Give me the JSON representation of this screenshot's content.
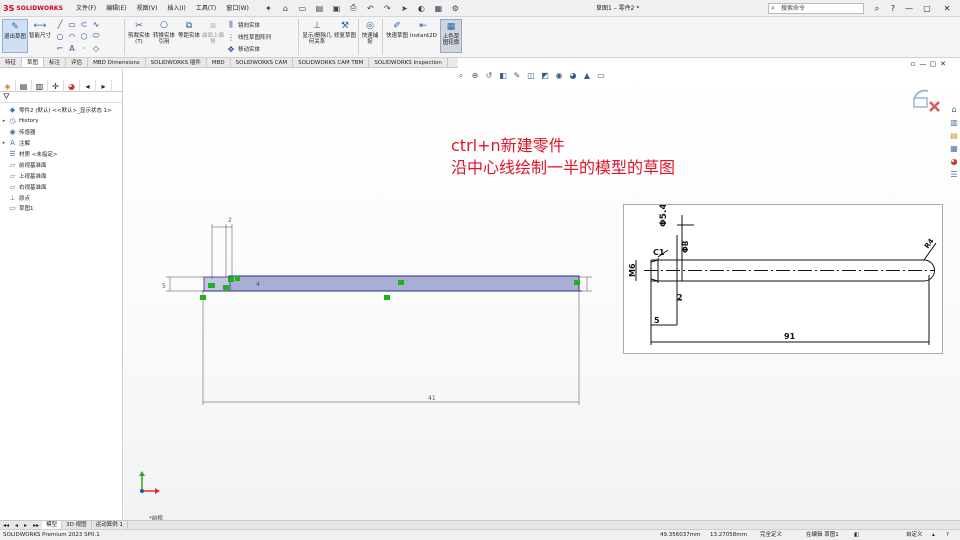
{
  "app": {
    "brand": "SOLIDWORKS",
    "document_title": "草图1 – 零件2 *"
  },
  "menu": [
    "文件(F)",
    "编辑(E)",
    "视图(V)",
    "插入(I)",
    "工具(T)",
    "窗口(W)"
  ],
  "search": {
    "placeholder": "搜索命令"
  },
  "ribbon": {
    "exit_sketch": "退出草图",
    "smart_dim": "智能尺寸",
    "trim": "剪裁实体(T)",
    "convert": "转换实体引用",
    "offset": "等距实体",
    "offset_surface": "曲面上偏移",
    "mirror": "镜向实体",
    "linear_pattern": "线性草图阵列",
    "move": "移动实体",
    "display_relations": "显示/删除几何关系",
    "repair": "修复草图",
    "rapid_snaps": "快速捕捉",
    "rapid_sketch": "快速草图",
    "instant2d": "Instant2D",
    "shaded_contours": "上色草图轮廓"
  },
  "command_tabs": [
    "特征",
    "草图",
    "标注",
    "评估",
    "MBD Dimensions",
    "SOLIDWORKS 插件",
    "MBD",
    "SOLIDWORKS CAM",
    "SOLIDWORKS CAM TBM",
    "SOLIDWORKS Inspection"
  ],
  "tree": [
    {
      "label": "零件2 (默认) <<默认>_显示状态 1>",
      "icon": "part-icon",
      "exp": ""
    },
    {
      "label": "History",
      "icon": "history-icon",
      "exp": "▸"
    },
    {
      "label": "传感器",
      "icon": "sensor-icon",
      "exp": ""
    },
    {
      "label": "注解",
      "icon": "annotation-icon",
      "exp": "▸"
    },
    {
      "label": "材质 <未指定>",
      "icon": "material-icon",
      "exp": ""
    },
    {
      "label": "前视基准面",
      "icon": "plane-icon",
      "exp": ""
    },
    {
      "label": "上视基准面",
      "icon": "plane-icon",
      "exp": ""
    },
    {
      "label": "右视基准面",
      "icon": "plane-icon",
      "exp": ""
    },
    {
      "label": "原点",
      "icon": "origin-icon",
      "exp": ""
    },
    {
      "label": "草图1",
      "icon": "sketch-icon",
      "exp": ""
    }
  ],
  "note": {
    "line1": "ctrl+n新建零件",
    "line2": "沿中心线绘制一半的模型的草图"
  },
  "sketch": {
    "dim_length": "41",
    "dim_top": "2",
    "dim_left": "5",
    "dim_right": "4"
  },
  "reference": {
    "d1": "Φ5.4",
    "d2": "Φ8",
    "c1": "C1",
    "m6": "M6",
    "r": "R4",
    "dim2": "2",
    "dim5": "5",
    "dim91": "91"
  },
  "view_name": "*前视",
  "model_tabs": [
    "模型",
    "3D 视图",
    "运动算例 1"
  ],
  "status": {
    "version": "SOLIDWORKS Premium 2023 SP0.1",
    "x": "49.356037mm",
    "y": "13.27058mm",
    "defined": "完全定义",
    "editing": "在编辑 草图1",
    "units": "自定义"
  },
  "colors": {
    "accent": "#d0021b",
    "note": "#e0152a",
    "shading": "#a9aed6",
    "relation": "#1db31d"
  }
}
